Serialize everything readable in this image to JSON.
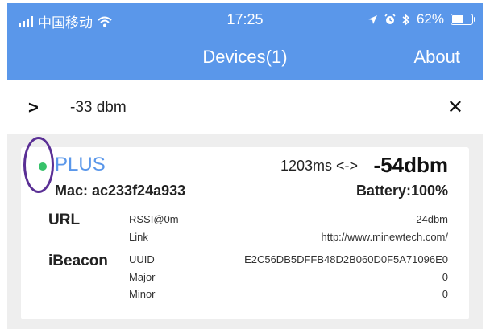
{
  "status_bar": {
    "carrier": "中国移动",
    "time": "17:25",
    "battery_text": "62%",
    "battery_level": 0.62
  },
  "nav": {
    "title": "Devices(1)",
    "about_label": "About"
  },
  "filter": {
    "value": "-33 dbm"
  },
  "device": {
    "name": "PLUS",
    "status_color": "#37c26a",
    "interval": "1203ms <->",
    "rssi": "-54dbm",
    "mac": "Mac: ac233f24a933",
    "battery": "Battery:100%",
    "frames": [
      {
        "type": "URL",
        "fields": [
          {
            "label": "RSSI@0m",
            "value": "-24dbm"
          },
          {
            "label": "Link",
            "value": "http://www.minewtech.com/"
          }
        ]
      },
      {
        "type": "iBeacon",
        "fields": [
          {
            "label": "UUID",
            "value": "E2C56DB5DFFB48D2B060D0F5A71096E0"
          },
          {
            "label": "Major",
            "value": "0"
          },
          {
            "label": "Minor",
            "value": "0"
          }
        ]
      }
    ]
  },
  "colors": {
    "nav_bar": "#5a97ea",
    "device_name": "#5a97ea",
    "annotation_ring": "#5a2f95"
  }
}
